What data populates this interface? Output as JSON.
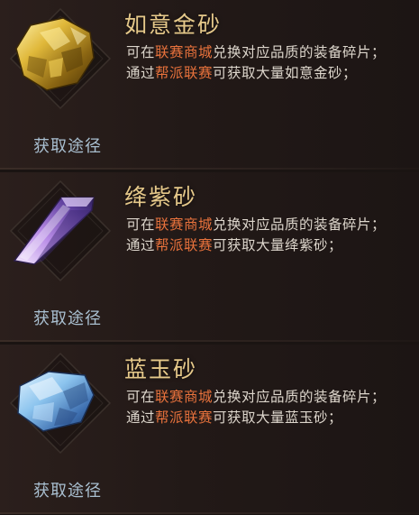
{
  "items": [
    {
      "name": "如意金砂",
      "line1_prefix": "可在",
      "line1_shop": "联赛商城",
      "line1_suffix": "兑换对应品质的装备碎片；",
      "line2_prefix": "通过",
      "line2_source": "帮派联赛",
      "line2_suffix": "可获取大量如意金砂；",
      "link": "获取途径",
      "gem_icon": "gold-ore-icon",
      "color": "#d9b23a"
    },
    {
      "name": "绛紫砂",
      "line1_prefix": "可在",
      "line1_shop": "联赛商城",
      "line1_suffix": "兑换对应品质的装备碎片；",
      "line2_prefix": "通过",
      "line2_source": "帮派联赛",
      "line2_suffix": "可获取大量绛紫砂；",
      "link": "获取途径",
      "gem_icon": "purple-crystal-icon",
      "color": "#b48ae0"
    },
    {
      "name": "蓝玉砂",
      "line1_prefix": "可在",
      "line1_shop": "联赛商城",
      "line1_suffix": "兑换对应品质的装备碎片；",
      "line2_prefix": "通过",
      "line2_source": "帮派联赛",
      "line2_suffix": "可获取大量蓝玉砂；",
      "link": "获取途径",
      "gem_icon": "blue-jade-icon",
      "color": "#7fb3e8"
    }
  ],
  "colors": {
    "title": "#e6c98a",
    "highlight": "#e8723c",
    "text": "#ddd6cc",
    "link": "#a9bfd0",
    "background": "#1a1412"
  }
}
